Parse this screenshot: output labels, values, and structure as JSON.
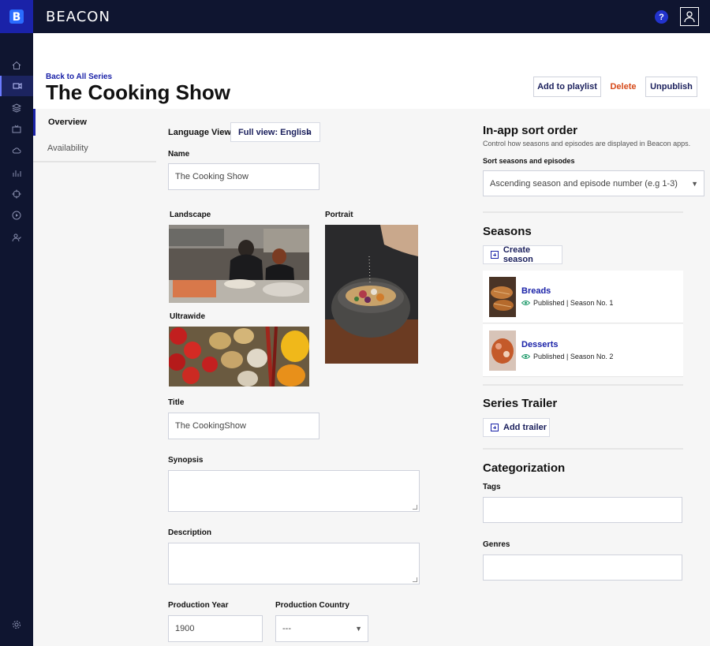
{
  "app": {
    "brand": "BEACON",
    "help": "?"
  },
  "header": {
    "back_link": "Back to All Series",
    "title": "The Cooking Show",
    "actions": {
      "add_to_playlist": "Add to playlist",
      "delete": "Delete",
      "unpublish": "Unpublish"
    }
  },
  "tabs": [
    {
      "label": "Overview"
    },
    {
      "label": "Availability"
    }
  ],
  "form": {
    "language_view_label": "Language View",
    "language_view_value": "Full view: English",
    "name_label": "Name",
    "name_value": "The Cooking Show",
    "landscape_label": "Landscape",
    "portrait_label": "Portrait",
    "ultrawide_label": "Ultrawide",
    "title_label": "Title",
    "title_value": "The CookingShow",
    "synopsis_label": "Synopsis",
    "description_label": "Description",
    "production_year_label": "Production Year",
    "production_year_value": "1900",
    "production_country_label": "Production Country",
    "production_country_value": "---"
  },
  "right": {
    "sort_title": "In-app sort order",
    "sort_desc": "Control how seasons and episodes are displayed in Beacon apps.",
    "sort_label": "Sort seasons and episodes",
    "sort_value": "Ascending season and episode number (e.g 1-3)",
    "seasons_title": "Seasons",
    "create_season": "Create season",
    "seasons": [
      {
        "name": "Breads",
        "meta": "Published | Season No. 1"
      },
      {
        "name": "Desserts",
        "meta": "Published | Season No. 2"
      }
    ],
    "trailer_title": "Series Trailer",
    "add_trailer": "Add trailer",
    "categorization_title": "Categorization",
    "tags_label": "Tags",
    "genres_label": "Genres"
  },
  "colors": {
    "accent": "#1a22a8",
    "topbar": "#0f1530",
    "danger": "#d64a1a",
    "published": "#1e9a6a"
  }
}
